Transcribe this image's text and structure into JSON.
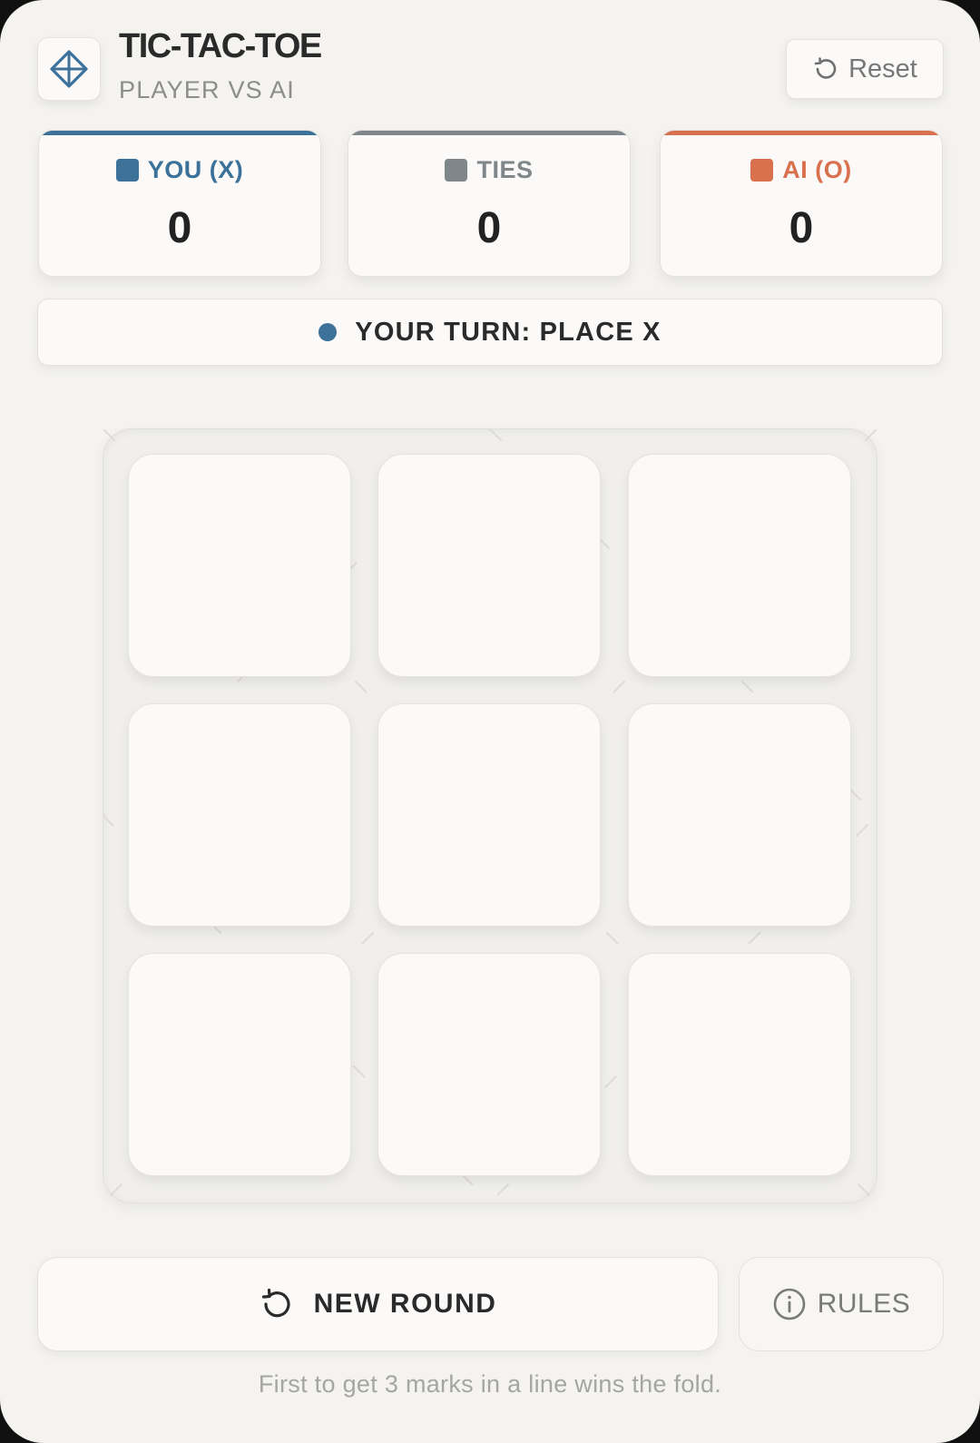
{
  "header": {
    "logo_icon": "diamond-crosshair-icon",
    "title": "TIC-TAC-TOE",
    "subtitle": "PLAYER VS AI",
    "reset_icon": "rotate-ccw-icon",
    "reset_label": "Reset"
  },
  "scores": [
    {
      "id": "you",
      "label": "YOU (X)",
      "value": "0",
      "color": "#3c7199"
    },
    {
      "id": "ties",
      "label": "TIES",
      "value": "0",
      "color": "#7f878b"
    },
    {
      "id": "ai",
      "label": "AI (O)",
      "value": "0",
      "color": "#d9714f"
    }
  ],
  "status": {
    "text": "YOUR TURN: PLACE X",
    "dot_color": "#3c7199"
  },
  "board": {
    "cells": [
      "",
      "",
      "",
      "",
      "",
      "",
      "",
      "",
      ""
    ]
  },
  "actions": {
    "new_round_icon": "rotate-ccw-icon",
    "new_round_label": "NEW ROUND",
    "rules_icon": "info-icon",
    "rules_label": "RULES"
  },
  "footer": {
    "text": "First to get 3 marks in a line wins the fold."
  }
}
